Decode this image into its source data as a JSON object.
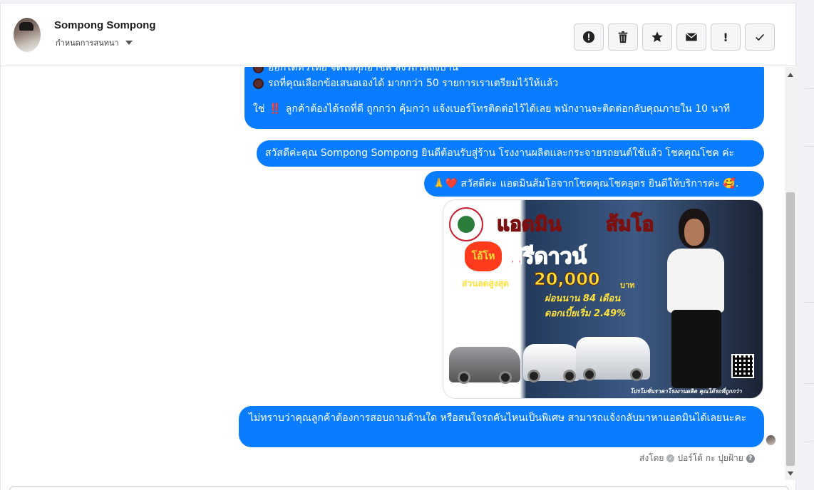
{
  "header": {
    "contact_name": "Sompong Sompong",
    "subtitle": "กำหนดการสนทนา",
    "actions": [
      {
        "icon": "alert-circle-icon",
        "label": "!"
      },
      {
        "icon": "trash-icon"
      },
      {
        "icon": "star-icon"
      },
      {
        "icon": "envelope-icon"
      },
      {
        "icon": "exclamation-icon",
        "label": "!"
      },
      {
        "icon": "checkmark-icon",
        "label": "✓"
      }
    ]
  },
  "messages": {
    "m1": {
      "line1": "ออกได้ทั่วไทย จัดได้ทุกอาชีพ ส่งรถให้ถึงบ้าน",
      "line2": "รถที่คุณเลือกข้อเสนอเองได้ มากกว่า 50 รายการเราเตรียมไว้ให้แล้ว",
      "line3_pre": "ใช่",
      "line3_mark": "‼️",
      "line3_post": "ลูกค้าต้องได้รถที่ดี ถูกกว่า คุ้มกว่า แจ้งเบอร์โทรติดต่อไว้ได้เลย พนักงานจะติดต่อกลับคุณภายใน 10 นาที"
    },
    "m2": "สวัสดีค่ะคุณ Sompong Sompong ยินดีต้อนรับสู่ร้าน โรงงานผลิตและกระจายรถยนต์ใช้แล้ว โชคคุณโชค ค่ะ",
    "m3": {
      "emoji_pray": "🙏",
      "emoji_heart": "❤️",
      "text": "สวัสดีค่ะ แอดมินส้มโอจากโชคคุณโชคอุดร ยินดีให้บริการค่ะ",
      "emoji_smile": "🥰",
      "end": "."
    },
    "image": {
      "title_a": "แอดมิน",
      "title_b": "ส้มโอ",
      "badge": "โอ้โห",
      "headline": "ฟรีดาวน์",
      "discount_label": "ส่วนลดสูงสุด",
      "discount_value": "20,000",
      "discount_unit": "บาท",
      "installments": "ผ่อนนาน 84 เดือน",
      "interest": "ดอกเบี้ยเริ่ม 2.49%",
      "caption": "โปรโมชั่นราคาโรงงานผลิต คุณได้รถที่ถูกกว่า"
    },
    "m4": "ไม่ทราบว่าคุณลูกค้าต้องการสอบถามด้านใด หรือสนใจรถคันไหนเป็นพิเศษ สามารถแจ้งกลับมาหาแอดมินได้เลยนะคะ"
  },
  "footer": {
    "sent_by_label": "ส่งโดย",
    "sender": "ปอร์โต้ กะ ปุยฝ้าย",
    "help": "?"
  },
  "colors": {
    "bubble": "#0a7cff",
    "background": "#ffffff",
    "muted_text": "#65676b"
  }
}
